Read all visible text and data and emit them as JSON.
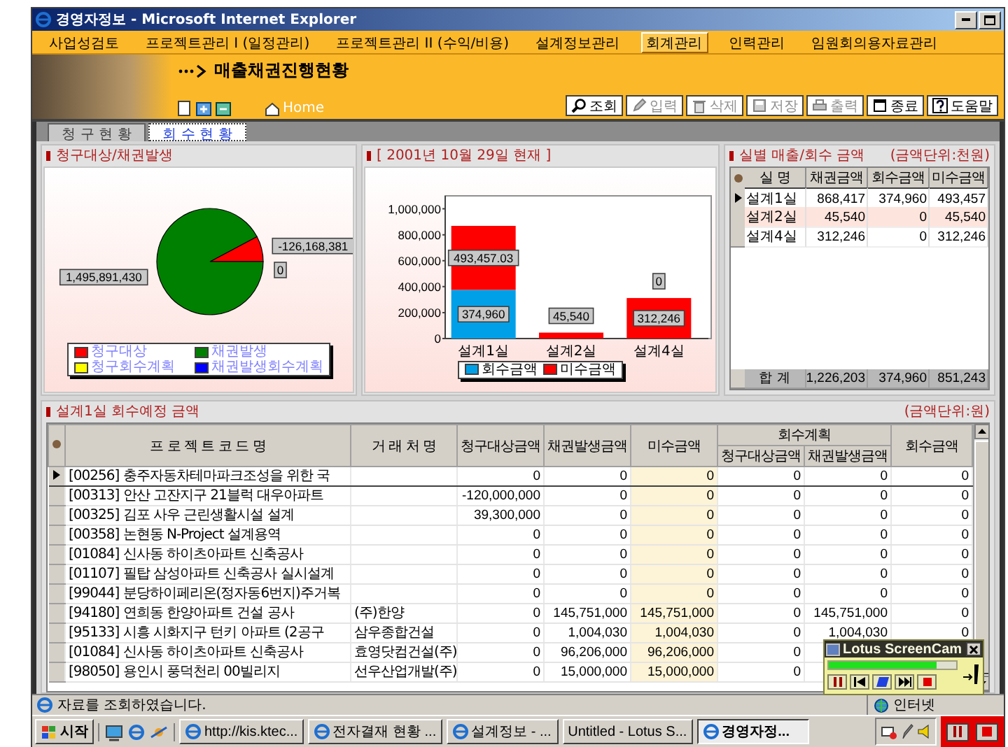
{
  "window": {
    "title": "경영자정보 - Microsoft Internet Explorer"
  },
  "menu": [
    {
      "label": "사업성검토",
      "selected": false
    },
    {
      "label": "프로젝트관리 I (일정관리)",
      "selected": false
    },
    {
      "label": "프로젝트관리 II (수익/비용)",
      "selected": false
    },
    {
      "label": "설계정보관리",
      "selected": false
    },
    {
      "label": "회계관리",
      "selected": true
    },
    {
      "label": "인력관리",
      "selected": false
    },
    {
      "label": "임원회의용자료관리",
      "selected": false
    }
  ],
  "header": {
    "title": "매출채권진행현황",
    "home": "Home"
  },
  "toolbar": [
    {
      "kind": "search",
      "label": "조회",
      "disabled": false
    },
    {
      "kind": "pencil",
      "label": "입력",
      "disabled": true
    },
    {
      "kind": "trash",
      "label": "삭제",
      "disabled": true
    },
    {
      "kind": "floppy",
      "label": "저장",
      "disabled": true
    },
    {
      "kind": "printer",
      "label": "출력",
      "disabled": true
    },
    {
      "kind": "window",
      "label": "종료",
      "disabled": false
    },
    {
      "kind": "help",
      "label": "도움말",
      "disabled": false
    }
  ],
  "tabs": [
    {
      "label": "청 구 현 황",
      "selected": false
    },
    {
      "label": "회 수 현 황",
      "selected": true
    }
  ],
  "pie_panel": {
    "title": "청구대상/채권발생",
    "chart_data": {
      "type": "pie",
      "categories": [
        "청구대상",
        "채권발생",
        "청구회수계획",
        "채권발생회수계획"
      ],
      "legend": "bottom",
      "values": [
        7.8,
        92.2,
        0,
        0
      ],
      "colors": [
        "#ff0000",
        "#008000",
        "#ffff00",
        "#0000ff"
      ]
    },
    "slice_labels": [
      "-126,168,381",
      "1,495,891,430",
      "0"
    ]
  },
  "bar_panel": {
    "title": "[ 2001년 10월 29일 현재 ]",
    "chart_data": {
      "type": "bar",
      "stacked": true,
      "legend": "bottom",
      "categories": [
        "설계1실",
        "설계2실",
        "설계4실"
      ],
      "series": [
        {
          "name": "회수금액",
          "color": "#00a0e8",
          "values": [
            374960,
            0,
            0
          ]
        },
        {
          "name": "미수금액",
          "color": "#ff0000",
          "values": [
            493457,
            45540,
            312246
          ]
        }
      ],
      "ylim": [
        0,
        1100000
      ],
      "yticks": [
        {
          "value": 0,
          "label": "0"
        },
        {
          "value": 200000,
          "label": "200,000"
        },
        {
          "value": 400000,
          "label": "400,000"
        },
        {
          "value": 600000,
          "label": "600,000"
        },
        {
          "value": 800000,
          "label": "800,000"
        },
        {
          "value": 1000000,
          "label": "1,000,000"
        }
      ],
      "value_labels": [
        [
          "374,960",
          null,
          "0"
        ],
        [
          "493,457.03",
          "45,540",
          "312,246"
        ]
      ]
    }
  },
  "summary": {
    "title": "실별 매출/회수 금액",
    "unit": "(금액단위:천원)",
    "columns": [
      "실 명",
      "채권금액",
      "회수금액",
      "미수금액"
    ],
    "rows": [
      {
        "cells": [
          "설계1실",
          "868,417",
          "374,960",
          "493,457"
        ],
        "selected": true,
        "highlighted": false
      },
      {
        "cells": [
          "설계2실",
          "45,540",
          "0",
          "45,540"
        ],
        "selected": false,
        "highlighted": true
      },
      {
        "cells": [
          "설계4실",
          "312,246",
          "0",
          "312,246"
        ],
        "selected": false,
        "highlighted": false
      }
    ],
    "total": [
      "합 계",
      "1,226,203",
      "374,960",
      "851,243"
    ]
  },
  "detail": {
    "title": "설계1실 회수예정 금액",
    "unit": "(금액단위:원)",
    "columns": [
      "프 로 젝 트 코 드 명",
      "거 래 처 명",
      "청구대상금액",
      "채권발생금액",
      "미수금액",
      "청구대상금액",
      "채권발생금액",
      "회수금액"
    ],
    "group": "회수계획",
    "rows": [
      {
        "cells": [
          "[00256] 충주자동차테마파크조성을 위한 국",
          null,
          "0",
          "0",
          "0",
          "0",
          "0",
          "0"
        ],
        "selected": true
      },
      {
        "cells": [
          "[00313] 안산 고잔지구 21블럭 대우아파트",
          null,
          "-120,000,000",
          "0",
          "0",
          "0",
          "0",
          "0"
        ],
        "selected": false
      },
      {
        "cells": [
          "[00325] 김포 사우 근린생활시설 설계",
          null,
          "39,300,000",
          "0",
          "0",
          "0",
          "0",
          "0"
        ],
        "selected": false
      },
      {
        "cells": [
          "[00358] 논현동 N-Project 설계용역",
          null,
          "0",
          "0",
          "0",
          "0",
          "0",
          "0"
        ],
        "selected": false
      },
      {
        "cells": [
          "[01084] 신사동 하이츠아파트 신축공사",
          null,
          "0",
          "0",
          "0",
          "0",
          "0",
          "0"
        ],
        "selected": false
      },
      {
        "cells": [
          "[01107] 필탑 삼성아파트 신축공사 실시설계",
          null,
          "0",
          "0",
          "0",
          "0",
          "0",
          "0"
        ],
        "selected": false
      },
      {
        "cells": [
          "[99044] 분당하이페리온(정자동6번지)주거복",
          null,
          "0",
          "0",
          "0",
          "0",
          "0",
          "0"
        ],
        "selected": false
      },
      {
        "cells": [
          "[94180] 연희동 한양아파트 건설 공사",
          "(주)한양",
          "0",
          "145,751,000",
          "145,751,000",
          "0",
          "145,751,000",
          "0"
        ],
        "selected": false
      },
      {
        "cells": [
          "[95133] 시흥 시화지구 턴키 아파트 (2공구",
          "삼우종합건설",
          "0",
          "1,004,030",
          "1,004,030",
          "0",
          "1,004,030",
          "0"
        ],
        "selected": false
      },
      {
        "cells": [
          "[01084] 신사동 하이츠아파트 신축공사",
          "효영닷컴건설(주)",
          "0",
          "96,206,000",
          "96,206,000",
          "0",
          null,
          null
        ],
        "selected": false
      },
      {
        "cells": [
          "[98050] 용인시 풍덕천리 00빌리지",
          "선우산업개발(주)",
          "0",
          "15,000,000",
          "15,000,000",
          "0",
          null,
          null
        ],
        "selected": false
      }
    ]
  },
  "status_bar": {
    "message": "자료를 조회하였습니다.",
    "zone": "인터넷"
  },
  "taskbar": {
    "start": "시작",
    "tasks": [
      {
        "kind": "browser",
        "label": "http://kis.ktec...",
        "selected": false
      },
      {
        "kind": "browser",
        "label": "전자결재 현황 ...",
        "selected": false
      },
      {
        "kind": "browser",
        "label": "설계정보 - ...",
        "selected": false
      },
      {
        "kind": "plain",
        "label": "Untitled - Lotus S...",
        "selected": false
      },
      {
        "kind": "browser",
        "label": "경영자정...",
        "selected": true
      }
    ]
  },
  "screencam": {
    "title": "Lotus ScreenCam",
    "level": 0.85
  }
}
